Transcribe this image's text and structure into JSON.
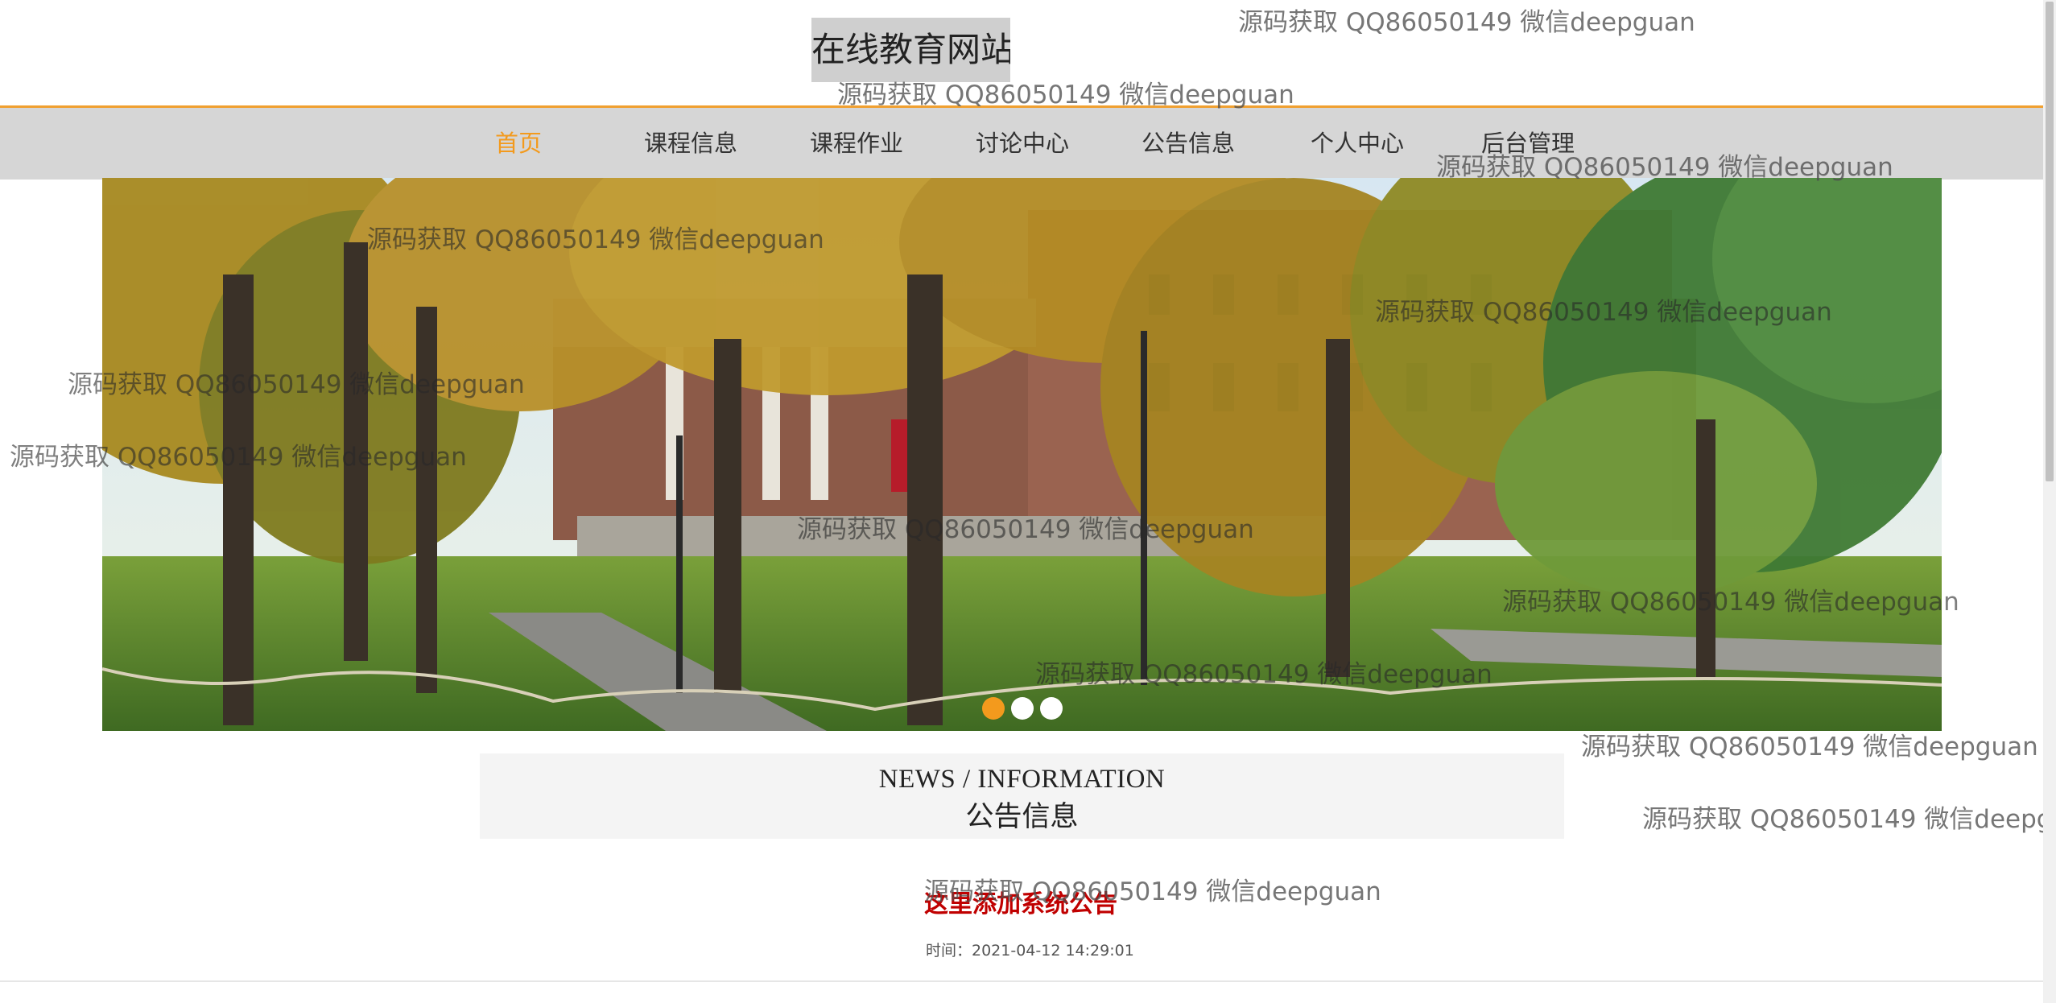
{
  "header": {
    "site_title": "在线教育网站"
  },
  "nav": {
    "items": [
      {
        "label": "首页",
        "active": true
      },
      {
        "label": "课程信息"
      },
      {
        "label": "课程作业"
      },
      {
        "label": "讨论中心"
      },
      {
        "label": "公告信息"
      },
      {
        "label": "个人中心"
      },
      {
        "label": "后台管理"
      }
    ]
  },
  "carousel": {
    "slide_count": 3,
    "active_slide": 1
  },
  "news": {
    "heading_en": "NEWS / INFORMATION",
    "heading_cn": "公告信息",
    "notice_title": "这里添加系统公告",
    "notice_time": "时间：2021-04-12 14:29:01"
  },
  "watermark": {
    "text": "源码获取 QQ86050149 微信deepguan"
  },
  "colors": {
    "accent": "#f39a1d",
    "notice_red": "#c00000",
    "nav_bg": "#d6d6d6"
  }
}
